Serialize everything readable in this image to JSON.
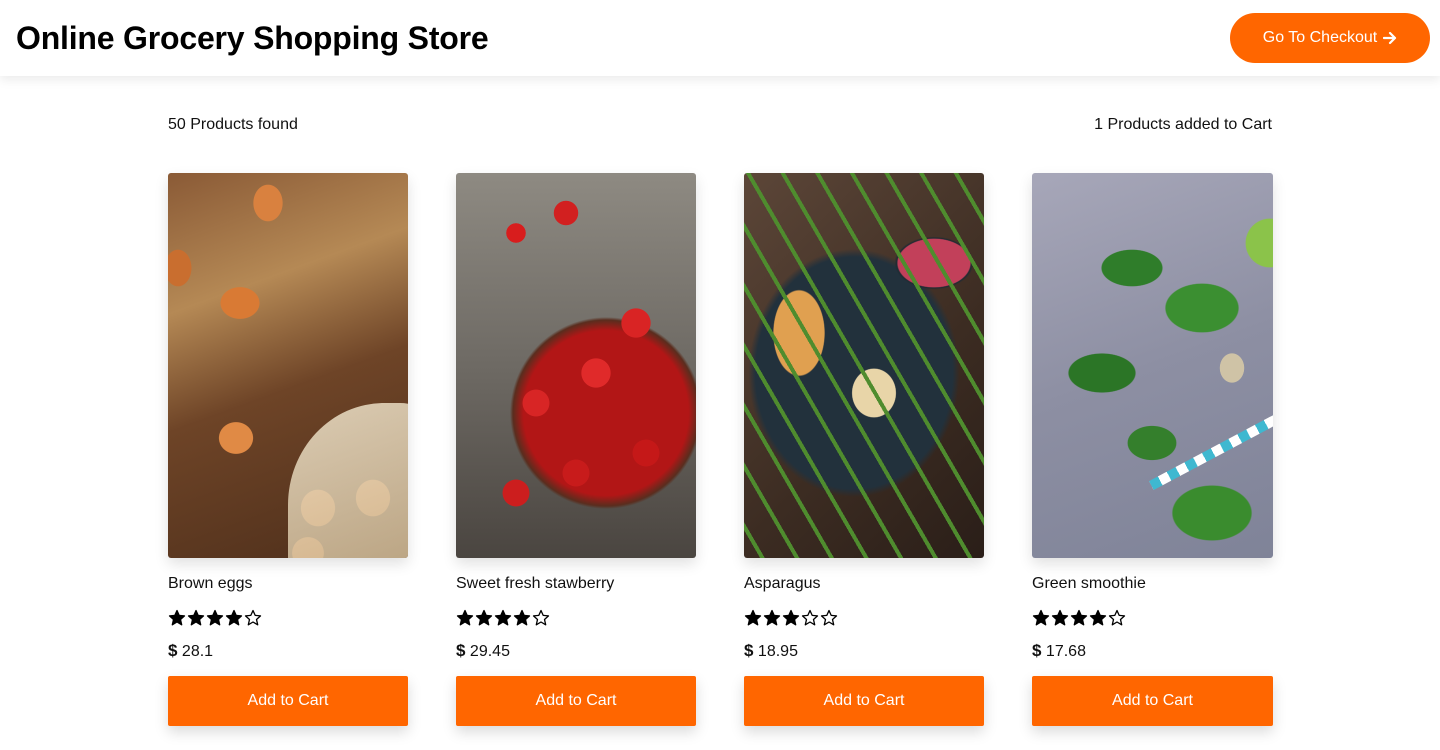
{
  "header": {
    "title": "Online Grocery Shopping Store",
    "checkout_label": "Go To Checkout"
  },
  "summary": {
    "products_found": "50 Products found",
    "cart_count": "1 Products added to Cart"
  },
  "colors": {
    "accent": "#ff6600"
  },
  "products": [
    {
      "name": "Brown eggs",
      "rating": 4,
      "rating_max": 5,
      "currency": "$",
      "price": "28.1",
      "button_label": "Add to Cart"
    },
    {
      "name": "Sweet fresh stawberry",
      "rating": 4,
      "rating_max": 5,
      "currency": "$",
      "price": "29.45",
      "button_label": "Add to Cart"
    },
    {
      "name": "Asparagus",
      "rating": 3,
      "rating_max": 5,
      "currency": "$",
      "price": "18.95",
      "button_label": "Add to Cart"
    },
    {
      "name": "Green smoothie",
      "rating": 4,
      "rating_max": 5,
      "currency": "$",
      "price": "17.68",
      "button_label": "Add to Cart"
    }
  ]
}
